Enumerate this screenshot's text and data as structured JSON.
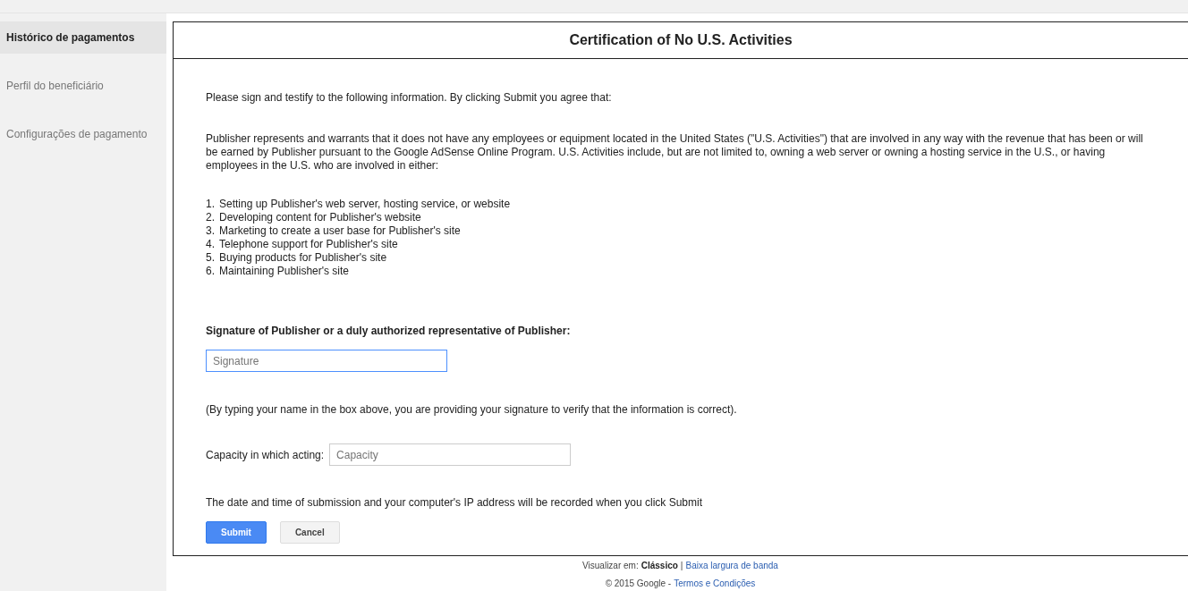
{
  "sidebar": {
    "items": [
      {
        "label": "Histórico de pagamentos",
        "selected": true
      },
      {
        "label": "Perfil do beneficiário",
        "selected": false
      },
      {
        "label": "Configurações de pagamento",
        "selected": false
      }
    ]
  },
  "dialog": {
    "title": "Certification of No U.S. Activities",
    "intro": "Please sign and testify to the following information. By clicking Submit you agree that:",
    "statement": "Publisher represents and warrants that it does not have any employees or equipment located in the United States (\"U.S. Activities\") that are involved in any way with the revenue that has been or will be earned by Publisher pursuant to the Google AdSense Online Program. U.S. Activities include, but are not limited to, owning a web server or owning a hosting service in the U.S., or having employees in the U.S. who are involved in either:",
    "activities": [
      {
        "number": "1.",
        "text": "Setting up Publisher's web server, hosting service, or website"
      },
      {
        "number": "2.",
        "text": "Developing content for Publisher's website"
      },
      {
        "number": "3.",
        "text": "Marketing to create a user base for Publisher's site"
      },
      {
        "number": "4.",
        "text": "Telephone support for Publisher's site"
      },
      {
        "number": "5.",
        "text": "Buying products for Publisher's site"
      },
      {
        "number": "6.",
        "text": "Maintaining Publisher's site"
      }
    ],
    "signature_heading": "Signature of Publisher or a duly authorized representative of Publisher:",
    "signature_field": {
      "placeholder": "Signature",
      "focused": true
    },
    "signature_note": "(By typing your name in the box above, you are providing your signature to verify that the information is correct).",
    "capacity_label": "Capacity in which acting:",
    "capacity_field": {
      "placeholder": "Capacity",
      "focused": false
    },
    "record_note": "The date and time of submission and your computer's IP address will be recorded when you click Submit",
    "buttons": [
      {
        "label": "Submit",
        "kind": "primary"
      },
      {
        "label": "Cancel",
        "kind": "secondary"
      }
    ]
  },
  "footer": {
    "view_label": "Visualizar em:",
    "view_current": "Clássico",
    "separator": "|",
    "view_link": "Baixa largura de banda",
    "copyright": "© 2015 Google -",
    "terms_link": "Termos e Condições"
  }
}
